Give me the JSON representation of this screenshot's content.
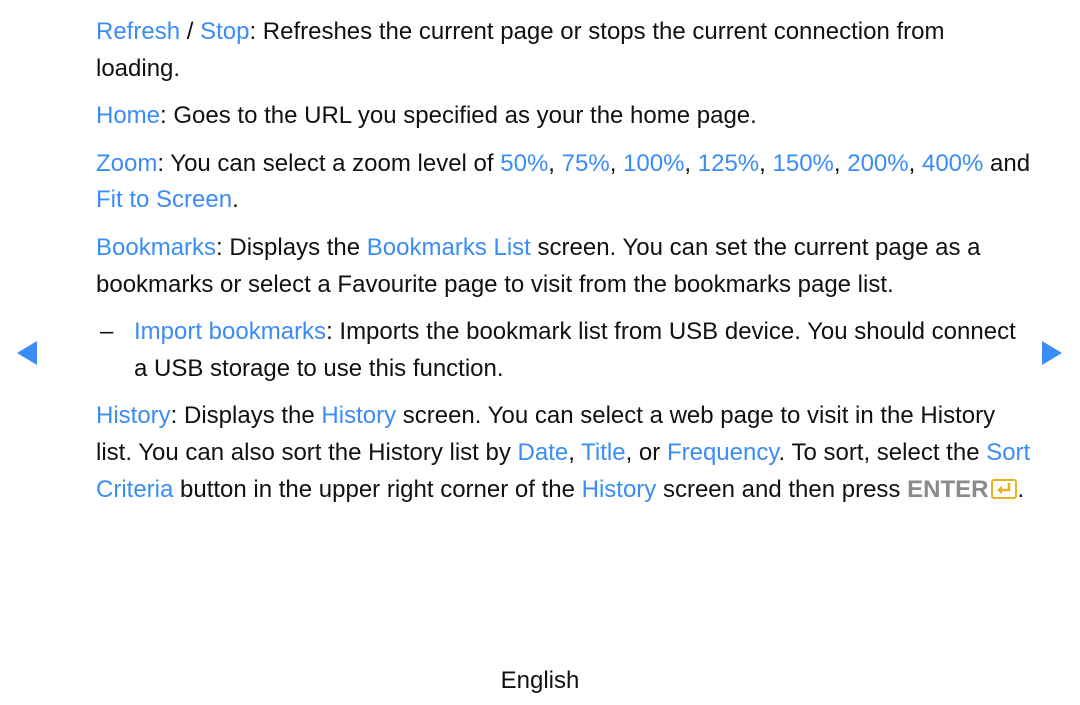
{
  "colors": {
    "highlight": "#3a8cf7",
    "enter_icon": "#e6b422",
    "enter_text": "#8a8a8a"
  },
  "paragraphs": [
    {
      "segments": [
        {
          "t": "hl",
          "v": "Refresh"
        },
        {
          "t": "text",
          "v": " / "
        },
        {
          "t": "hl",
          "v": "Stop"
        },
        {
          "t": "text",
          "v": ": Refreshes the current page or stops the current connection from loading."
        }
      ]
    },
    {
      "segments": [
        {
          "t": "hl",
          "v": "Home"
        },
        {
          "t": "text",
          "v": ": Goes to the URL you specified as your the home page."
        }
      ]
    },
    {
      "segments": [
        {
          "t": "hl",
          "v": "Zoom"
        },
        {
          "t": "text",
          "v": ": You can select a zoom level of "
        },
        {
          "t": "hl",
          "v": "50%"
        },
        {
          "t": "text",
          "v": ", "
        },
        {
          "t": "hl",
          "v": "75%"
        },
        {
          "t": "text",
          "v": ", "
        },
        {
          "t": "hl",
          "v": "100%"
        },
        {
          "t": "text",
          "v": ", "
        },
        {
          "t": "hl",
          "v": "125%"
        },
        {
          "t": "text",
          "v": ", "
        },
        {
          "t": "hl",
          "v": "150%"
        },
        {
          "t": "text",
          "v": ", "
        },
        {
          "t": "hl",
          "v": "200%"
        },
        {
          "t": "text",
          "v": ", "
        },
        {
          "t": "hl",
          "v": "400%"
        },
        {
          "t": "text",
          "v": " and "
        },
        {
          "t": "hl",
          "v": "Fit to Screen"
        },
        {
          "t": "text",
          "v": "."
        }
      ]
    },
    {
      "segments": [
        {
          "t": "hl",
          "v": "Bookmarks"
        },
        {
          "t": "text",
          "v": ": Displays the "
        },
        {
          "t": "hl",
          "v": "Bookmarks List"
        },
        {
          "t": "text",
          "v": " screen. You can set the current page as a bookmarks or select a Favourite page to visit from the bookmarks page list."
        }
      ]
    },
    {
      "sub": true,
      "dash": "–",
      "segments": [
        {
          "t": "hl",
          "v": "Import bookmarks"
        },
        {
          "t": "text",
          "v": ": Imports the bookmark list from USB device. You should connect a USB storage to use this function."
        }
      ]
    },
    {
      "segments": [
        {
          "t": "hl",
          "v": "History"
        },
        {
          "t": "text",
          "v": ": Displays the "
        },
        {
          "t": "hl",
          "v": "History"
        },
        {
          "t": "text",
          "v": " screen. You can select a web page to visit in the History list. You can also sort the History list by "
        },
        {
          "t": "hl",
          "v": "Date"
        },
        {
          "t": "text",
          "v": ", "
        },
        {
          "t": "hl",
          "v": "Title"
        },
        {
          "t": "text",
          "v": ", or "
        },
        {
          "t": "hl",
          "v": "Frequency"
        },
        {
          "t": "text",
          "v": ". To sort, select the "
        },
        {
          "t": "hl",
          "v": "Sort Criteria"
        },
        {
          "t": "text",
          "v": " button in the upper right corner of the "
        },
        {
          "t": "hl",
          "v": "History"
        },
        {
          "t": "text",
          "v": " screen and then press "
        },
        {
          "t": "enter",
          "v": "ENTER"
        },
        {
          "t": "icon",
          "v": "enter-icon"
        },
        {
          "t": "text",
          "v": "."
        }
      ]
    }
  ],
  "nav": {
    "prev_icon": "triangle-left-icon",
    "next_icon": "triangle-right-icon"
  },
  "footer": {
    "language": "English"
  }
}
